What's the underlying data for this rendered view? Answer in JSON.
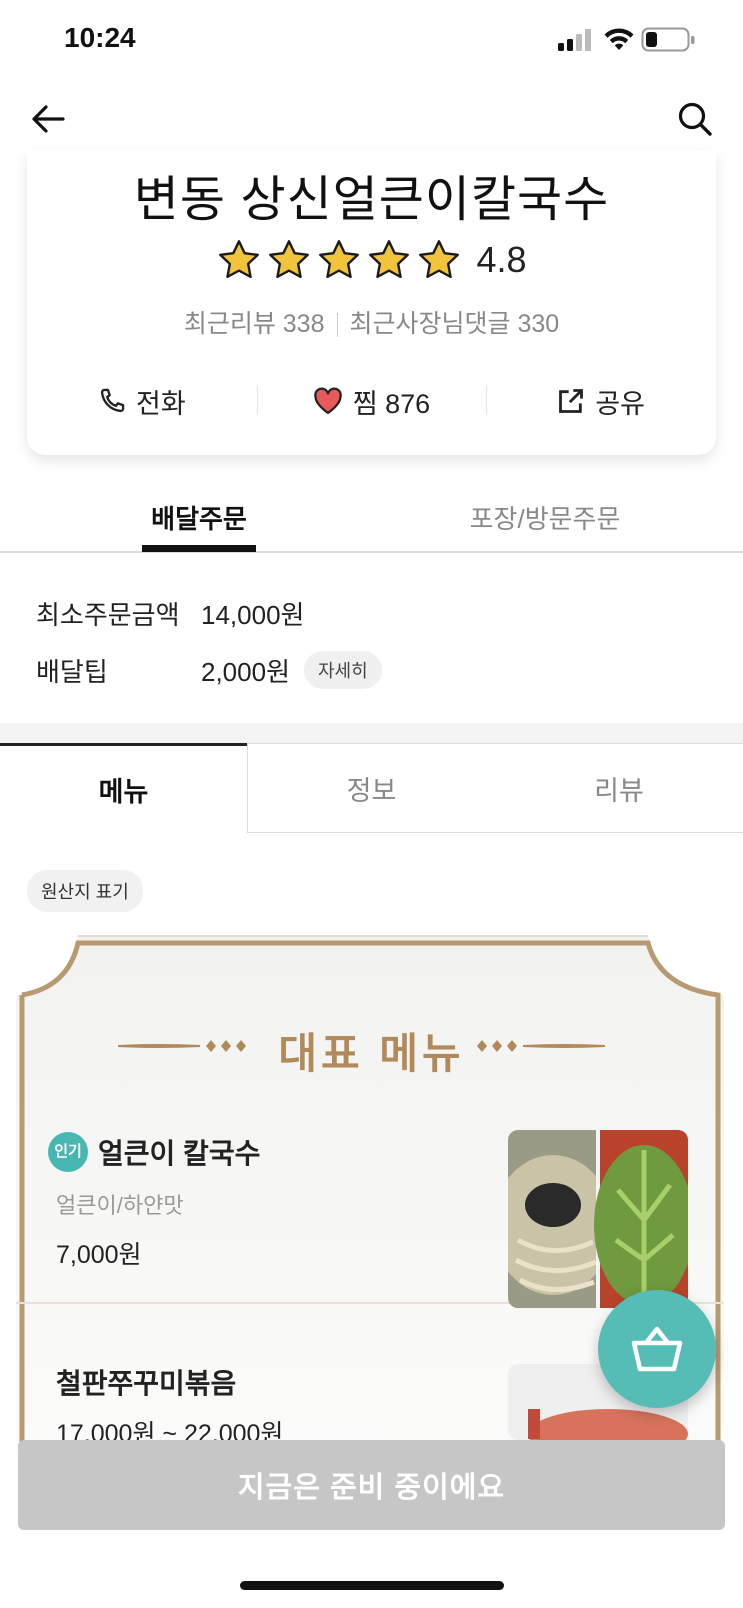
{
  "status_bar": {
    "time": "10:24"
  },
  "store": {
    "name": "변동 상신얼큰이칼국수",
    "rating": "4.8",
    "stars_filled": 5,
    "recent_reviews": "최근리뷰 338",
    "owner_replies": "최근사장님댓글 330",
    "actions": {
      "call": "전화",
      "like": "찜 876",
      "share": "공유"
    }
  },
  "order_tabs": {
    "delivery": "배달주문",
    "pickup": "포장/방문주문"
  },
  "order_info": {
    "min_order_label": "최소주문금액",
    "min_order_value": "14,000원",
    "tip_label": "배달팁",
    "tip_value": "2,000원",
    "detail_label": "자세히"
  },
  "menu_tabs": {
    "menu": "메뉴",
    "info": "정보",
    "review": "리뷰"
  },
  "origin_label": "원산지 표기",
  "rep_menu": {
    "title": "대표 메뉴",
    "items": [
      {
        "badge": "인기",
        "name": "얼큰이 칼국수",
        "desc": "얼큰이/하얀맛",
        "price": "7,000원"
      },
      {
        "name": "철판쭈꾸미볶음",
        "price": "17,000원 ~ 22,000원"
      }
    ]
  },
  "bottom_bar": {
    "label": "지금은 준비 중이에요"
  },
  "colors": {
    "accent_teal": "#56bdb6",
    "gold": "#b08a5a",
    "disabled_gray": "#c6c6c6"
  }
}
